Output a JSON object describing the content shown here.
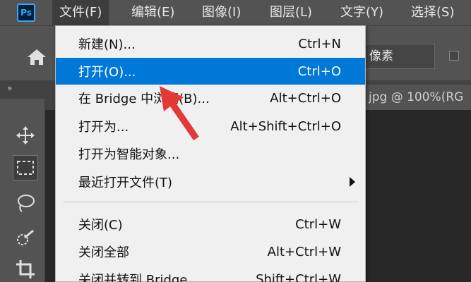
{
  "app": {
    "logo_text": "Ps",
    "logo_color": "#31a8ff"
  },
  "menubar": {
    "items": [
      {
        "label": "文件(F)"
      },
      {
        "label": "编辑(E)"
      },
      {
        "label": "图像(I)"
      },
      {
        "label": "图层(L)"
      },
      {
        "label": "文字(Y)"
      },
      {
        "label": "选择(S)"
      }
    ]
  },
  "optionsbar": {
    "unit_value": "像素"
  },
  "document": {
    "tab_label": "jpg @ 100%(RG"
  },
  "file_menu": {
    "items": [
      {
        "label": "新建(N)...",
        "shortcut": "Ctrl+N"
      },
      {
        "label": "打开(O)...",
        "shortcut": "Ctrl+O"
      },
      {
        "label": "在 Bridge 中浏览(B)...",
        "shortcut": "Alt+Ctrl+O"
      },
      {
        "label": "打开为...",
        "shortcut": "Alt+Shift+Ctrl+O"
      },
      {
        "label": "打开为智能对象...",
        "shortcut": ""
      },
      {
        "label": "最近打开文件(T)",
        "shortcut": ""
      },
      {
        "label": "关闭(C)",
        "shortcut": "Ctrl+W"
      },
      {
        "label": "关闭全部",
        "shortcut": "Alt+Ctrl+W"
      },
      {
        "label": "关闭并转到 Bridge...",
        "shortcut": "Shift+Ctrl+W"
      }
    ]
  },
  "colors": {
    "highlight": "#0078d7",
    "annotation_arrow": "#e53935"
  }
}
